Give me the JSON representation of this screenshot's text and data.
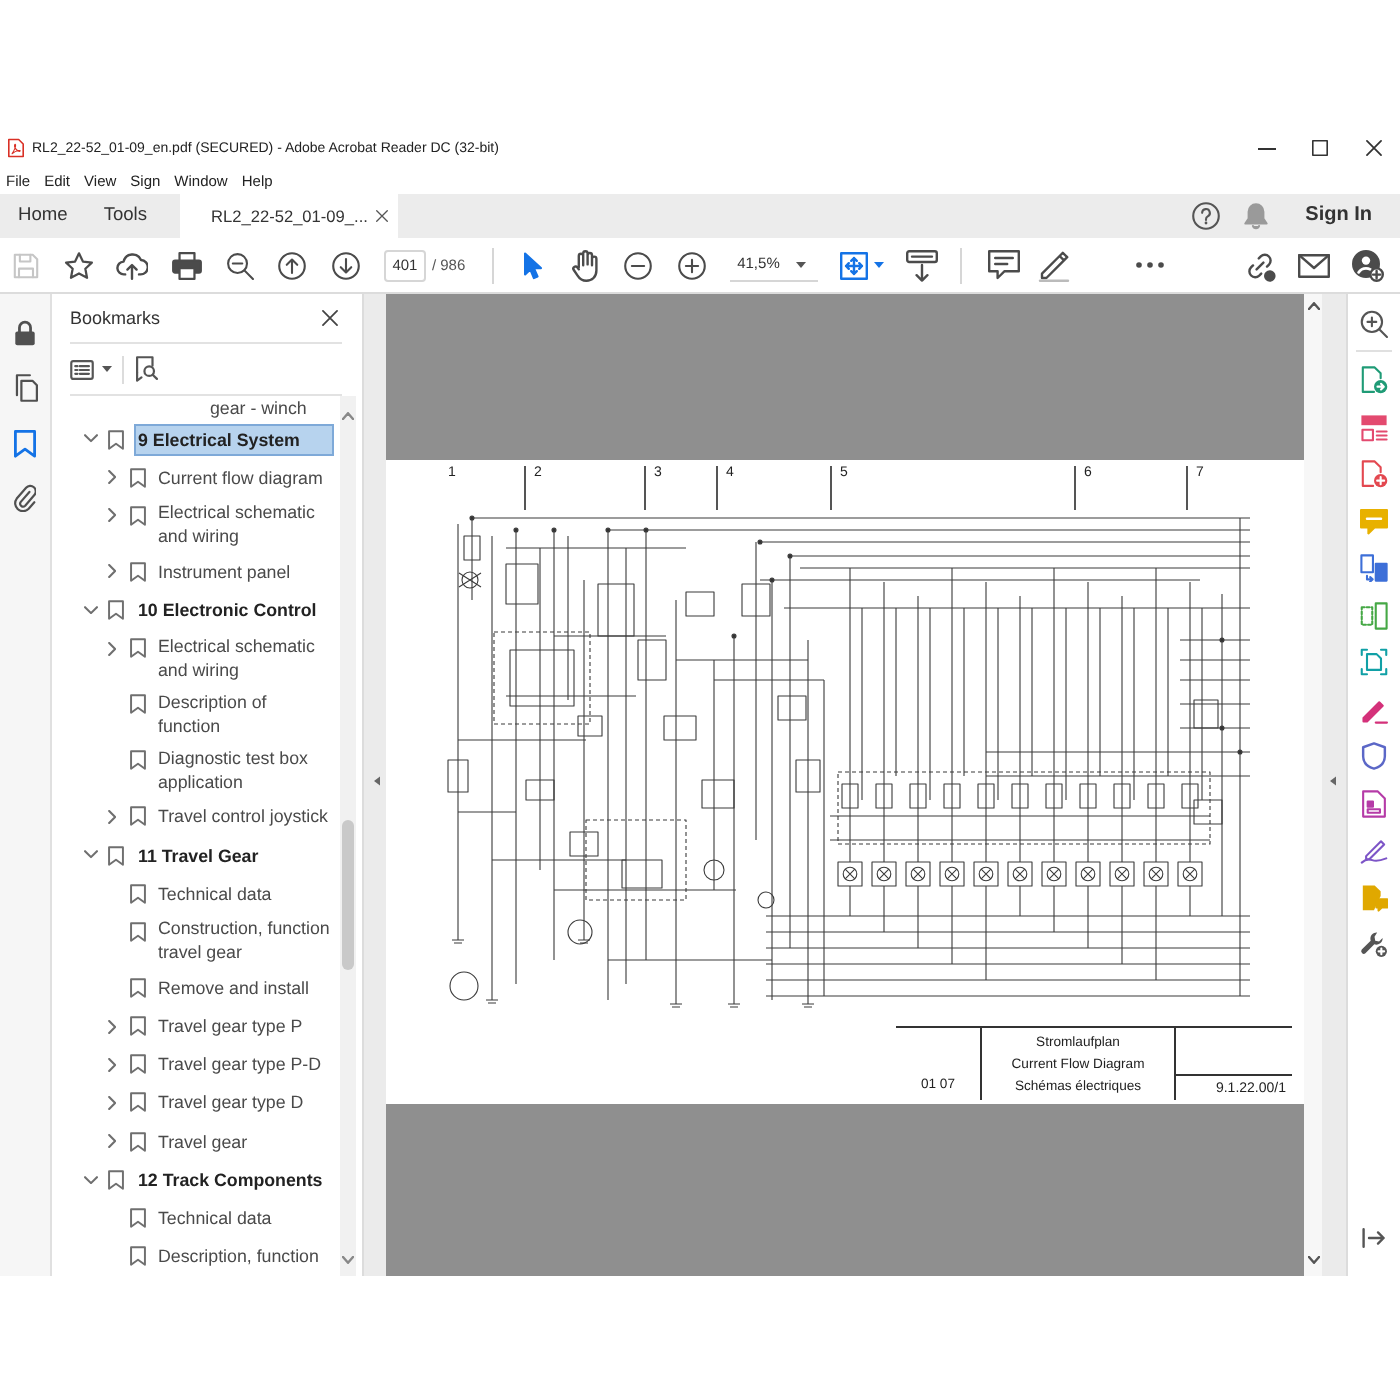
{
  "window": {
    "title": "RL2_22-52_01-09_en.pdf (SECURED) - Adobe Acrobat Reader DC (32-bit)"
  },
  "menu_bar": [
    "File",
    "Edit",
    "View",
    "Sign",
    "Window",
    "Help"
  ],
  "tabs": [
    {
      "kind": "nav",
      "label": "Home",
      "selected": false
    },
    {
      "kind": "nav",
      "label": "Tools",
      "selected": false
    },
    {
      "kind": "document",
      "label": "RL2_22-52_01-09_...",
      "selected": true
    }
  ],
  "account": {
    "sign_in": "Sign In"
  },
  "toolbar": {
    "save": {
      "disabled": true
    },
    "page_number": "401",
    "page_count": "/ 986",
    "pointer_tools": [
      {
        "kind": "select",
        "selected": true
      },
      {
        "kind": "hand",
        "selected": false
      }
    ],
    "zoom": "41,5%"
  },
  "left_rail": [
    {
      "kind": "lock",
      "selected": false
    },
    {
      "kind": "pages",
      "selected": false
    },
    {
      "kind": "bookmarks",
      "selected": true
    },
    {
      "kind": "attachments",
      "selected": false
    }
  ],
  "bookmarks": {
    "title": "Bookmarks",
    "cut_off_item": {
      "label": "gear - winch"
    },
    "items": [
      {
        "label": "9 Electrical System",
        "selected": true,
        "expandable": true,
        "expanded": true,
        "children": [
          {
            "label": "Current flow diagram",
            "selected": false,
            "expandable": true,
            "expanded": false
          },
          {
            "label": "Electrical schematic and wiring",
            "selected": false,
            "expandable": true,
            "expanded": false
          },
          {
            "label": "Instrument panel",
            "selected": false,
            "expandable": true,
            "expanded": false
          }
        ]
      },
      {
        "label": "10 Electronic Control",
        "selected": false,
        "expandable": true,
        "expanded": true,
        "children": [
          {
            "label": "Electrical schematic and wiring",
            "selected": false,
            "expandable": true,
            "expanded": false
          },
          {
            "label": "Description of function",
            "selected": false,
            "expandable": false
          },
          {
            "label": "Diagnostic test box application",
            "selected": false,
            "expandable": false
          },
          {
            "label": "Travel control joystick",
            "selected": false,
            "expandable": true,
            "expanded": false
          }
        ]
      },
      {
        "label": "11 Travel Gear",
        "selected": false,
        "expandable": true,
        "expanded": true,
        "children": [
          {
            "label": "Technical data",
            "selected": false,
            "expandable": false
          },
          {
            "label": "Construction, function travel gear",
            "selected": false,
            "expandable": false
          },
          {
            "label": "Remove and install",
            "selected": false,
            "expandable": false
          },
          {
            "label": "Travel gear type P",
            "selected": false,
            "expandable": true,
            "expanded": false
          },
          {
            "label": "Travel gear type P-D",
            "selected": false,
            "expandable": true,
            "expanded": false
          },
          {
            "label": "Travel gear type D",
            "selected": false,
            "expandable": true,
            "expanded": false
          },
          {
            "label": "Travel gear",
            "selected": false,
            "expandable": true,
            "expanded": false
          }
        ]
      },
      {
        "label": "12 Track Components",
        "selected": false,
        "expandable": true,
        "expanded": true,
        "children": [
          {
            "label": "Technical data",
            "selected": false,
            "expandable": false
          },
          {
            "label": "Description, function",
            "selected": false,
            "expandable": false
          }
        ]
      }
    ]
  },
  "document": {
    "column_numbers": [
      "1",
      "2",
      "3",
      "4",
      "5",
      "6",
      "7"
    ],
    "title_block": {
      "date": "01 07",
      "title_de": "Stromlaufplan",
      "title_en": "Current Flow Diagram",
      "title_fr": "Schémas électriques",
      "drawing_number": "9.1.22.00/1"
    }
  }
}
